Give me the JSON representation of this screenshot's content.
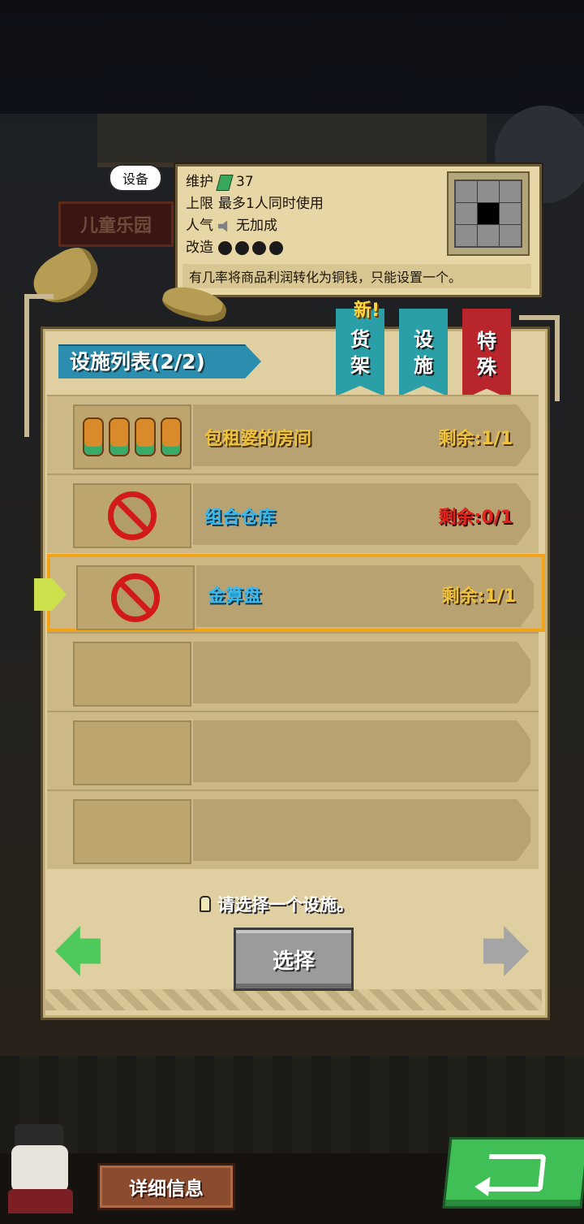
{
  "background": {
    "sign_text": "儿童乐园"
  },
  "info": {
    "tag": "设备",
    "maintenance_label": "维护",
    "maintenance_value": "37",
    "limit_label": "上限",
    "limit_value": "最多1人同时使用",
    "popularity_label": "人气",
    "popularity_value": "无加成",
    "modify_label": "改造",
    "modify_level": 4,
    "description": "有几率将商品利润转化为铜钱，只能设置一个。"
  },
  "panel": {
    "title": "设施列表(2/2)",
    "new_badge": "新!",
    "tabs": [
      {
        "line1": "货",
        "line2": "架"
      },
      {
        "line1": "设",
        "line2": "施"
      },
      {
        "line1": "特",
        "line2": "殊"
      }
    ],
    "active_tab": "特殊"
  },
  "facilities": [
    {
      "name": "包租婆的房间",
      "count": "剩余:1/1",
      "available": true
    },
    {
      "name": "组合仓库",
      "count": "剩余:0/1",
      "available": false
    },
    {
      "name": "金算盘",
      "count": "剩余:1/1",
      "available": true,
      "selected": true
    }
  ],
  "hint": "请选择一个设施。",
  "buttons": {
    "select": "选择",
    "detail": "详细信息"
  },
  "colors": {
    "accent_gold": "#f0c33c",
    "accent_cyan": "#39b9ee",
    "alert_red": "#e3221b",
    "selected_border": "#f3a318",
    "tab_teal": "#2a9fa8",
    "tab_red": "#b8262c",
    "confirm_green": "#3fbf55"
  }
}
